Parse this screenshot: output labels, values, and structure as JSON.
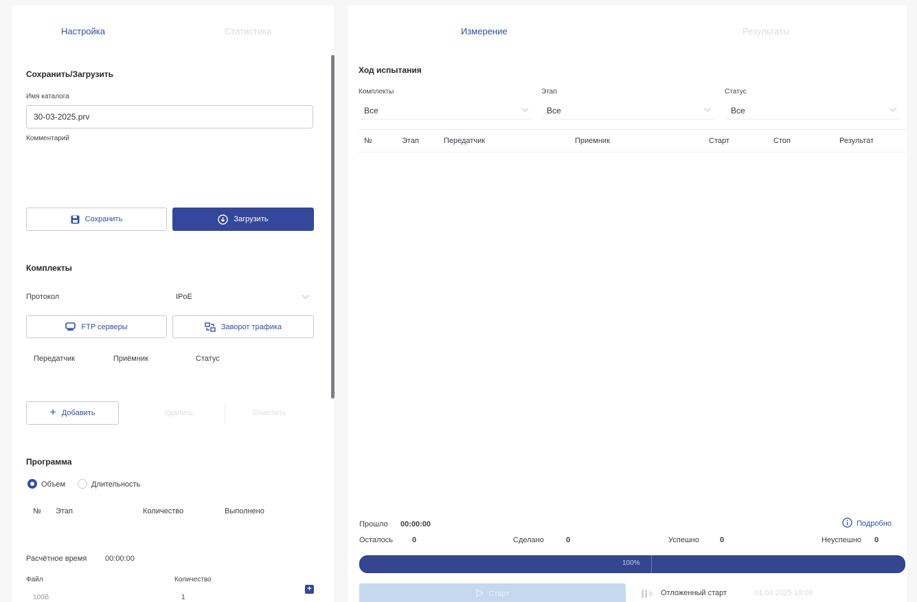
{
  "tabs": {
    "settings": "Настройка",
    "statistics": "Статистика",
    "measurement": "Измерение",
    "results": "Результаты"
  },
  "save_load": {
    "title": "Сохранить/Загрузить",
    "catalog_label": "Имя каталога",
    "catalog_value": "30-03-2025.prv",
    "comment_label": "Комментарий",
    "save_button": "Сохранить",
    "load_button": "Загрузить"
  },
  "kits": {
    "title": "Комплекты",
    "protocol_label": "Протокол",
    "protocol_value": "IPoE",
    "ftp_button": "FTP серверы",
    "traffic_button": "Заворот трафика",
    "columns": [
      "Передатчик",
      "Приёмник",
      "Статус"
    ],
    "add_button": "Добавить",
    "delete_button": "Удалить",
    "clear_button": "Очистить"
  },
  "program": {
    "title": "Программа",
    "radio_volume": "Объем",
    "radio_duration": "Длительность",
    "columns": [
      "№",
      "Этап",
      "Количество",
      "Выполнено"
    ],
    "calc_time_label": "Расчётное время",
    "calc_time_value": "00:00:00",
    "file_label": "Файл",
    "quantity_label": "Количество",
    "file_value": "100B",
    "quantity_value": "1"
  },
  "progress_section": {
    "title": "Ход испытания",
    "filter_kits_label": "Комплекты",
    "filter_stage_label": "Этап",
    "filter_status_label": "Статус",
    "filter_kits_value": "Все",
    "filter_stage_value": "Все",
    "filter_status_value": "Все",
    "columns": [
      "№",
      "Этап",
      "Передатчик",
      "Приемник",
      "Старт",
      "Стоп",
      "Результат"
    ]
  },
  "summary": {
    "elapsed_label": "Прошло",
    "elapsed_value": "00:00:00",
    "details_link": "Подробно",
    "remaining_label": "Осталось",
    "remaining_value": "0",
    "done_label": "Сделано",
    "done_value": "0",
    "success_label": "Успешно",
    "success_value": "0",
    "fail_label": "Неуспешно",
    "fail_value": "0",
    "progress_text": "100%",
    "progress_fraction": 1.0
  },
  "footer": {
    "start_button": "Старт",
    "deferred_start_label": "Отложенный старт",
    "deferred_start_value": "01.04.2025 19:06"
  },
  "colors": {
    "accent": "#2f4fa8",
    "primary_button": "#35479a",
    "progress_bar": "#3c4f9e"
  }
}
